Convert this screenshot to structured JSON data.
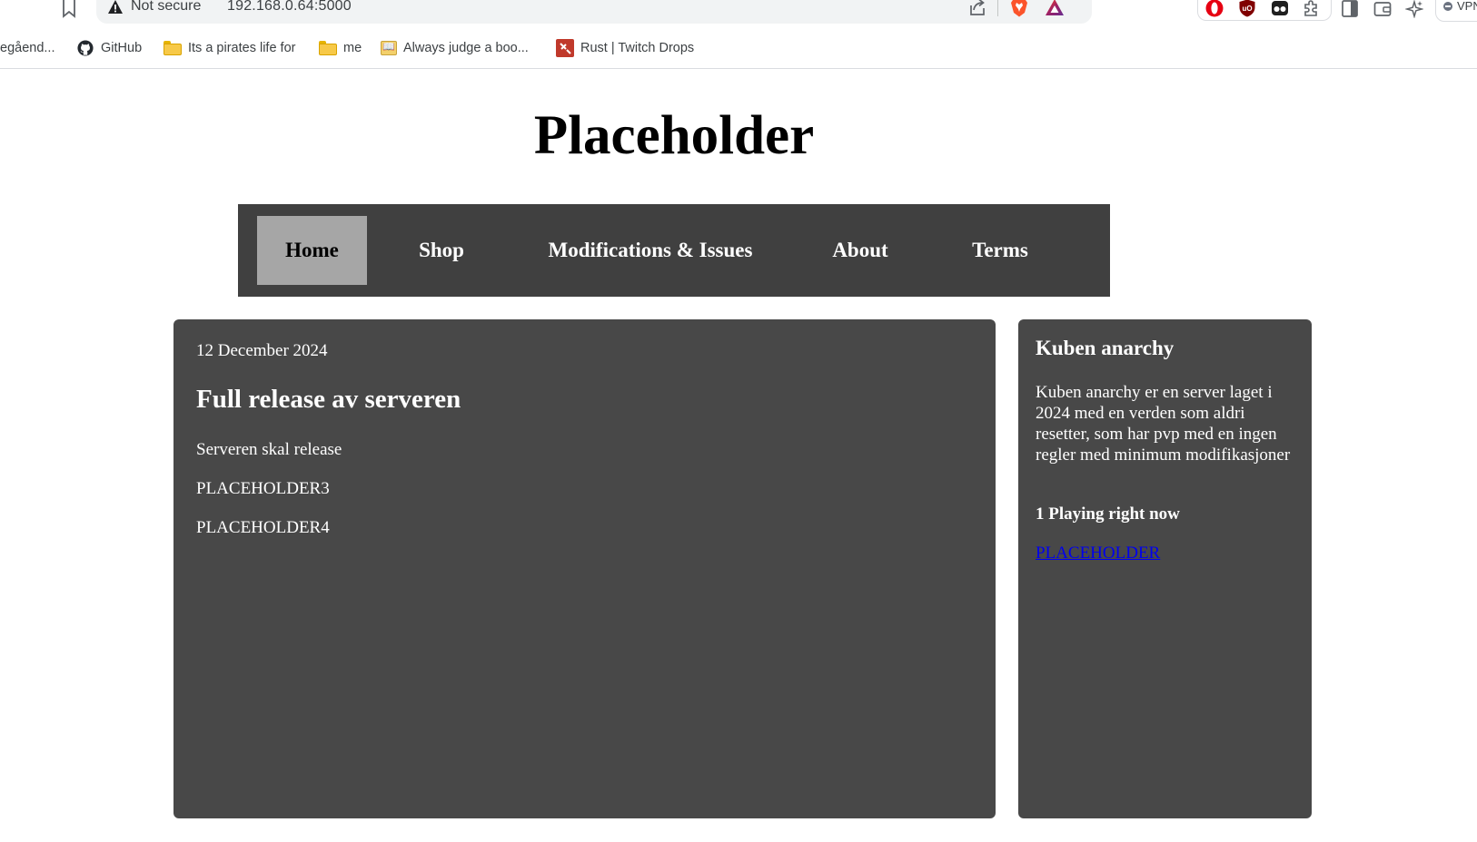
{
  "browser": {
    "security_label": "Not secure",
    "url": "192.168.0.64:5000",
    "vpn_label": "VPN"
  },
  "bookmarks": [
    {
      "label": "egåend...",
      "icon": "none"
    },
    {
      "label": "GitHub",
      "icon": "github-icon"
    },
    {
      "label": "Its a pirates life for",
      "icon": "folder-icon"
    },
    {
      "label": "me",
      "icon": "folder-icon"
    },
    {
      "label": "Always judge a boo...",
      "icon": "book-icon"
    },
    {
      "label": "Rust | Twitch Drops",
      "icon": "rust-icon"
    }
  ],
  "site": {
    "title": "Placeholder"
  },
  "nav": {
    "items": [
      {
        "label": "Home",
        "active": true
      },
      {
        "label": "Shop",
        "active": false
      },
      {
        "label": "Modifications & Issues",
        "active": false
      },
      {
        "label": "About",
        "active": false
      },
      {
        "label": "Terms",
        "active": false
      }
    ]
  },
  "news": {
    "date": "12 December 2024",
    "title": "Full release av serveren",
    "paragraphs": [
      "Serveren skal release",
      "PLACEHOLDER3",
      "PLACEHOLDER4"
    ]
  },
  "sidebar": {
    "title": "Kuben anarchy",
    "description": "Kuben anarchy er en server laget i 2024 med en verden som aldri resetter, som har pvp med en ingen regler med minimum modifikasjoner",
    "players": "1 Playing right now",
    "link": "PLACEHOLDER"
  },
  "colors": {
    "nav_bg": "#404040",
    "nav_active_bg": "#a6a6a6",
    "panel_bg": "#484848",
    "link": "#0000ee"
  }
}
